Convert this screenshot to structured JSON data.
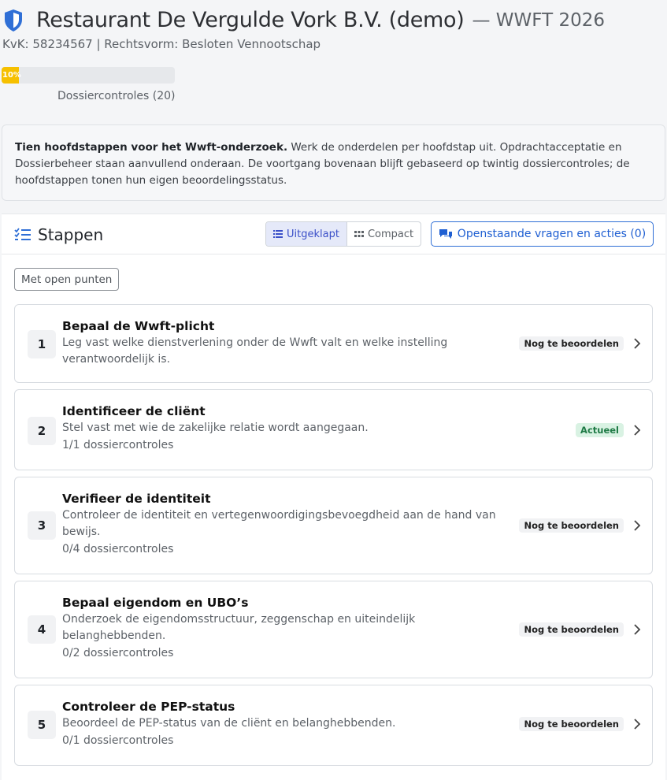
{
  "header": {
    "company": "Restaurant De Vergulde Vork B.V. (demo)",
    "subtitle": "— WWFT 2026",
    "kvk": "KvK: 58234567 | Rechtsvorm: Besloten Vennootschap",
    "progress_label": "10%",
    "progress_value": 0.1,
    "progress_caption": "Dossiercontroles (20)"
  },
  "info": {
    "bold": "Tien hoofdstappen voor het Wwft-onderzoek.",
    "text": " Werk de onderdelen per hoofdstap uit. Opdrachtacceptatie en Dossierbeheer staan aanvullend onderaan. De voortgang bovenaan blijft gebaseerd op twintig dossiercontroles; de hoofdstappen tonen hun eigen beoordelingsstatus."
  },
  "panel": {
    "title": "Stappen",
    "view_expanded": "Uitgeklapt",
    "view_compact": "Compact",
    "open_questions": "Openstaande vragen en acties (0)",
    "filter": "Met open punten"
  },
  "steps": [
    {
      "num": "1",
      "title": "Bepaal de Wwft-plicht",
      "desc": "Leg vast welke dienstverlening onder de Wwft valt en welke instelling verantwoordelijk is.",
      "count": "",
      "status": "Nog te beoordelen"
    },
    {
      "num": "2",
      "title": "Identificeer de cliënt",
      "desc": "Stel vast met wie de zakelijke relatie wordt aangegaan.",
      "count": "1/1 dossiercontroles",
      "status": "Actueel"
    },
    {
      "num": "3",
      "title": "Verifieer de identiteit",
      "desc": "Controleer de identiteit en vertegenwoordigingsbevoegdheid aan de hand van bewijs.",
      "count": "0/4 dossiercontroles",
      "status": "Nog te beoordelen"
    },
    {
      "num": "4",
      "title": "Bepaal eigendom en UBO’s",
      "desc": "Onderzoek de eigendomsstructuur, zeggenschap en uiteindelijk belanghebbenden.",
      "count": "0/2 dossiercontroles",
      "status": "Nog te beoordelen"
    },
    {
      "num": "5",
      "title": "Controleer de PEP-status",
      "desc": "Beoordeel de PEP-status van de cliënt en belanghebbenden.",
      "count": "0/1 dossiercontroles",
      "status": "Nog te beoordelen"
    }
  ],
  "colors": {
    "accent": "#2f6fd6",
    "progress": "#f6c000",
    "status_current": "#1e7a45"
  }
}
